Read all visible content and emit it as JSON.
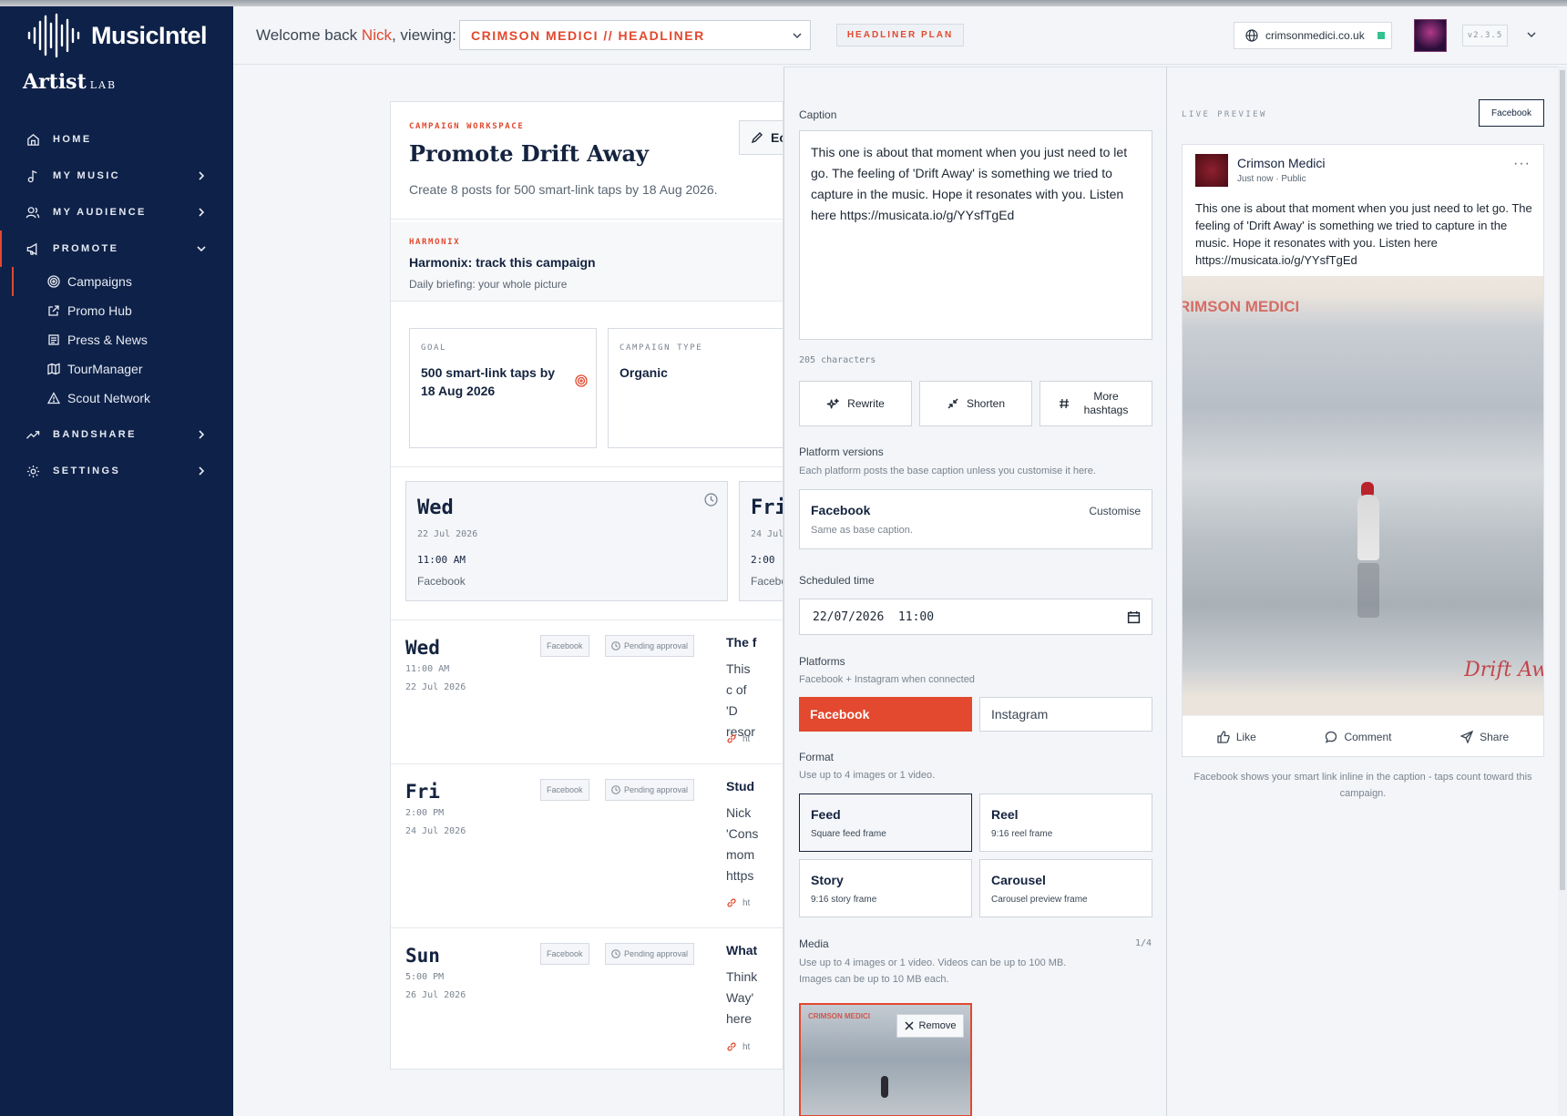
{
  "brand": {
    "name": "MusicIntel",
    "lab": "Artist",
    "lab_suffix": "LAB"
  },
  "nav": {
    "home": "HOME",
    "my_music": "MY MUSIC",
    "my_audience": "MY AUDIENCE",
    "promote": "PROMOTE",
    "sub": [
      "Campaigns",
      "Promo Hub",
      "Press & News",
      "TourManager",
      "Scout Network"
    ],
    "bandshare": "BANDSHARE",
    "settings": "SETTINGS"
  },
  "header": {
    "welcome_prefix": "Welcome back",
    "user": "Nick",
    "welcome_suffix": ", viewing:",
    "artist": "CRIMSON MEDICI // HEADLINER",
    "plan": "HEADLINER PLAN",
    "domain": "crimsonmedici.co.uk",
    "version": "v2.3.5"
  },
  "workspace": {
    "kicker": "CAMPAIGN WORKSPACE",
    "title": "Promote Drift Away",
    "subtitle": "Create 8 posts for 500 smart-link taps by 18 Aug 2026.",
    "edit_label": "Ec",
    "harmonix_kicker": "HARMONIX",
    "harmonix_title": "Harmonix: track this campaign",
    "harmonix_sub": "Daily briefing: your whole picture",
    "goal_label": "GOAL",
    "goal_value": "500 smart-link taps by 18 Aug 2026",
    "type_label": "CAMPAIGN TYPE",
    "type_value": "Organic",
    "sched_cards": [
      {
        "day": "Wed",
        "date": "22 Jul 2026",
        "time": "11:00 AM",
        "platform": "Facebook"
      },
      {
        "day": "Fri",
        "date": "24 Jul",
        "time": "2:00",
        "platform": "Facebo"
      }
    ],
    "posts": [
      {
        "day": "Wed",
        "time": "11:00 AM",
        "date": "22 Jul 2026",
        "platform": "Facebook",
        "status": "Pending approval",
        "title": "The f",
        "body": "This c of 'D resor",
        "link": "ht"
      },
      {
        "day": "Fri",
        "time": "2:00 PM",
        "date": "24 Jul 2026",
        "platform": "Facebook",
        "status": "Pending approval",
        "title": "Stud",
        "body": "Nick 'Cons mom https",
        "link": "ht"
      },
      {
        "day": "Sun",
        "time": "5:00 PM",
        "date": "26 Jul 2026",
        "platform": "Facebook",
        "status": "Pending approval",
        "title": "What",
        "body": "Think Way' here",
        "link": "ht"
      }
    ]
  },
  "editor": {
    "caption_label": "Caption",
    "caption_text": "This one is about that moment when you just need to let go. The feeling of 'Drift Away' is something we tried to capture in the music. Hope it resonates with you. Listen here https://musicata.io/g/YYsfTgEd",
    "char_count": "205 characters",
    "actions": [
      "Rewrite",
      "Shorten",
      "More hashtags"
    ],
    "versions_label": "Platform versions",
    "versions_hint": "Each platform posts the base caption unless you customise it here.",
    "version_platform": "Facebook",
    "version_status": "Same as base caption.",
    "version_action": "Customise",
    "scheduled_label": "Scheduled time",
    "scheduled_value": "22/07/2026  11:00",
    "platforms_label": "Platforms",
    "platforms_hint": "Facebook + Instagram when connected",
    "platform_on": "Facebook",
    "platform_off": "Instagram",
    "format_label": "Format",
    "format_hint": "Use up to 4 images or 1 video.",
    "formats": [
      {
        "name": "Feed",
        "desc": "Square feed frame"
      },
      {
        "name": "Reel",
        "desc": "9:16 reel frame"
      },
      {
        "name": "Story",
        "desc": "9:16 story frame"
      },
      {
        "name": "Carousel",
        "desc": "Carousel preview frame"
      }
    ],
    "media_label": "Media",
    "media_count": "1/4",
    "media_hint": "Use up to 4 images or 1 video. Videos can be up to 100 MB. Images can be up to 10 MB each.",
    "media_thumb_text": "CRIMSON MEDICI",
    "remove_label": "Remove"
  },
  "preview": {
    "kicker": "LIVE PREVIEW",
    "platform": "Facebook",
    "page_name": "Crimson Medici",
    "meta": "Just now · Public",
    "text": "This one is about that moment when you just need to let go. The feeling of 'Drift Away' is something we tried to capture in the music. Hope it resonates with you. Listen here https://musicata.io/g/YYsfTgEd",
    "image_text": "RIMSON MEDICI",
    "image_signature": "Drift Aw",
    "like": "Like",
    "comment": "Comment",
    "share": "Share",
    "note": "Facebook shows your smart link inline in the caption - taps count toward this campaign."
  }
}
